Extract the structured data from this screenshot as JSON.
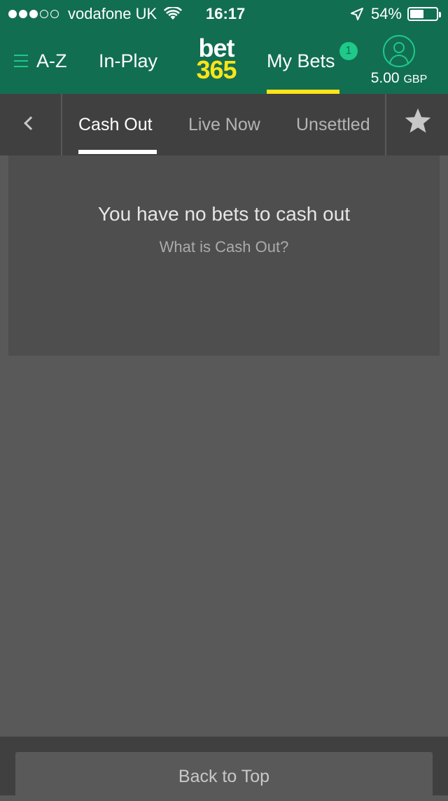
{
  "status_bar": {
    "carrier": "vodafone UK",
    "time": "16:17",
    "battery_percent_label": "54%",
    "battery_level": 0.54,
    "signal_bars_filled": 3,
    "signal_bars_total": 5
  },
  "header": {
    "az_label": "A-Z",
    "inplay_label": "In-Play",
    "logo_top": "bet",
    "logo_bottom": "365",
    "mybets_label": "My Bets",
    "mybets_badge": "1",
    "balance_amount": "5.00",
    "balance_currency": "GBP"
  },
  "subtabs": {
    "tabs": [
      {
        "label": "Cash Out",
        "active": true
      },
      {
        "label": "Live Now",
        "active": false
      },
      {
        "label": "Unsettled",
        "active": false
      }
    ]
  },
  "content": {
    "empty_title": "You have no bets to cash out",
    "empty_link": "What is Cash Out?"
  },
  "footer": {
    "back_to_top": "Back to Top"
  },
  "colors": {
    "brand_green": "#126e51",
    "accent_green": "#1ec98a",
    "brand_yellow": "#ffe418",
    "background": "#595959"
  }
}
